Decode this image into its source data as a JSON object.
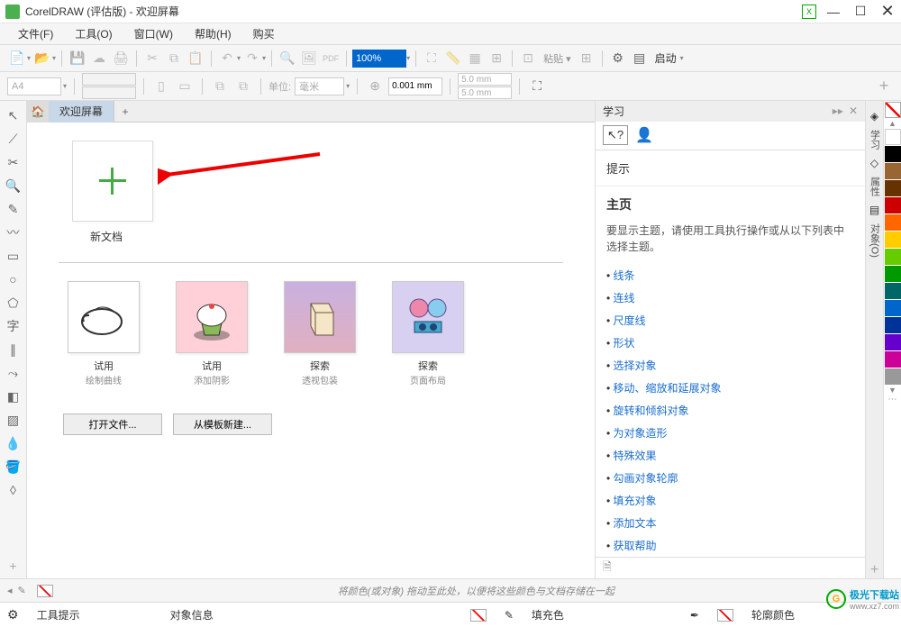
{
  "titlebar": {
    "title": "CorelDRAW (评估版) - 欢迎屏幕"
  },
  "menu": {
    "file": "文件(F)",
    "tools": "工具(O)",
    "window": "窗口(W)",
    "help": "帮助(H)",
    "buy": "购买"
  },
  "toolbar": {
    "zoom": "100%",
    "paste_label": "粘贴 ▾",
    "launch": "启动"
  },
  "propbar": {
    "paper": "A4",
    "unit_label": "单位:",
    "mm": "毫米",
    "nudge": "0.001 mm",
    "dup_x": "5.0 mm",
    "dup_y": "5.0 mm"
  },
  "tabs": {
    "welcome": "欢迎屏幕"
  },
  "welcome": {
    "new_doc": "新文档",
    "thumbs": [
      {
        "t1": "试用",
        "t2": "绘制曲线"
      },
      {
        "t1": "试用",
        "t2": "添加阴影"
      },
      {
        "t1": "探索",
        "t2": "透视包装"
      },
      {
        "t1": "探索",
        "t2": "页面布局"
      }
    ],
    "open_file": "打开文件...",
    "new_from_template": "从模板新建..."
  },
  "learn": {
    "title": "学习",
    "hints": "提示",
    "home": "主页",
    "desc": "要显示主题，请使用工具执行操作或从以下列表中选择主题。",
    "links": [
      "线条",
      "连线",
      "尺度线",
      "形状",
      "选择对象",
      "移动、缩放和延展对象",
      "旋转和倾斜对象",
      "为对象造形",
      "特殊效果",
      "勾画对象轮廓",
      "填充对象",
      "添加文本",
      "获取帮助"
    ]
  },
  "right_tabs": [
    "学习",
    "属性",
    "对象(O)"
  ],
  "colors": [
    "#ffffff",
    "#000000",
    "#996633",
    "#663300",
    "#cc0000",
    "#ff6600",
    "#ffcc00",
    "#66cc00",
    "#009900",
    "#006666",
    "#0066cc",
    "#003399",
    "#6600cc",
    "#cc0099",
    "#999999"
  ],
  "status1": {
    "hint": "将颜色(或对象) 拖动至此处，以便将这些颜色与文档存储在一起"
  },
  "status2": {
    "tool_hint": "工具提示",
    "obj_info": "对象信息",
    "fill": "填充色",
    "outline": "轮廓颜色"
  },
  "corner": {
    "text": "极光下载站",
    "url": "www.xz7.com"
  }
}
